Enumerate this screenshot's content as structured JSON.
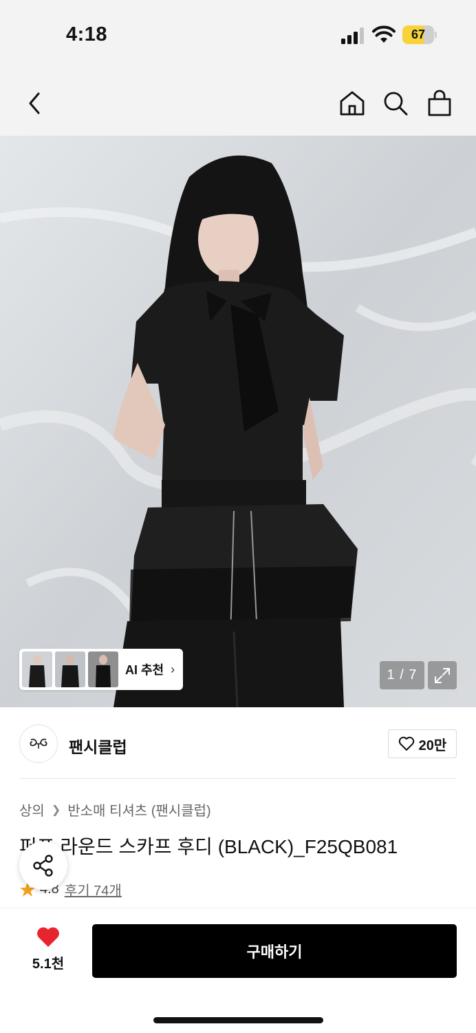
{
  "status_bar": {
    "time": "4:18",
    "battery": "67",
    "battery_level": 0.67
  },
  "nav": {
    "icons": [
      "chevron-left-icon",
      "home-icon",
      "search-icon",
      "shopping-bag-icon"
    ]
  },
  "gallery": {
    "ai_label": "AI 추천",
    "counter": "1 / 7"
  },
  "brand": {
    "name": "팬시클럽",
    "likes": "20만"
  },
  "product": {
    "breadcrumb": [
      "상의",
      "반소매 티셔츠 (팬시클럽)"
    ],
    "title": "퍼프 라운드 스카프 후디 (BLACK)_F25QB081",
    "rating": "4.8",
    "reviews": "후기 74개"
  },
  "bottom_bar": {
    "like_count": "5.1천",
    "buy_label": "구매하기"
  },
  "colors": {
    "accent_red": "#e8242e",
    "buy_button": "#000000",
    "star": "#f2a21a",
    "battery": "#f7d339"
  }
}
